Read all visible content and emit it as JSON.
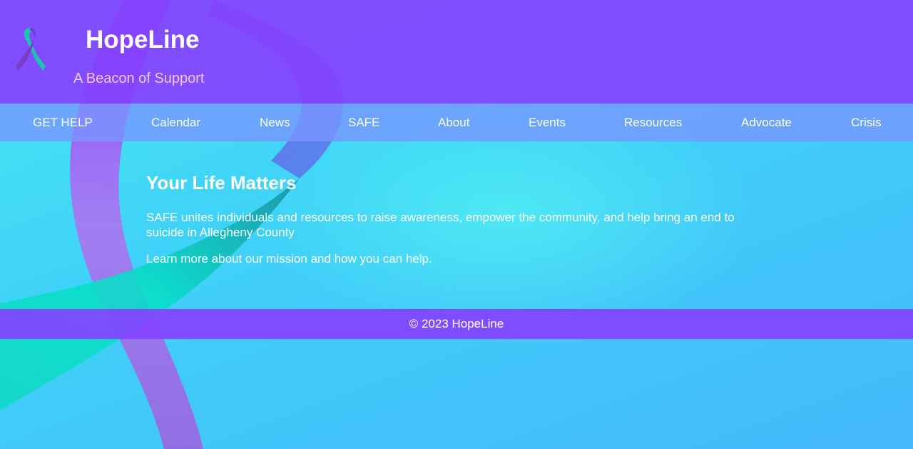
{
  "header": {
    "title": "HopeLine",
    "tagline": "A Beacon of Support",
    "logo_icon": "awareness-ribbon-icon"
  },
  "nav": {
    "items": [
      {
        "label": "GET HELP"
      },
      {
        "label": "Calendar"
      },
      {
        "label": "News"
      },
      {
        "label": "SAFE"
      },
      {
        "label": "About"
      },
      {
        "label": "Events"
      },
      {
        "label": "Resources"
      },
      {
        "label": "Advocate"
      },
      {
        "label": "Crisis"
      }
    ]
  },
  "main": {
    "heading": "Your Life Matters",
    "paragraph1": "SAFE unites individuals and resources to raise awareness, empower the community, and help bring an end to suicide in Allegheny County",
    "paragraph2": "Learn more about our mission and how you can help."
  },
  "footer": {
    "copyright": "© 2023 HopeLine"
  },
  "colors": {
    "header_bg": "#8442ff",
    "nav_bg": "#7896ff",
    "tagline": "#f5c7ee",
    "ribbon_purple": "#a033ff",
    "ribbon_teal": "#0fe8c8",
    "page_bg": "#42c8f8"
  }
}
